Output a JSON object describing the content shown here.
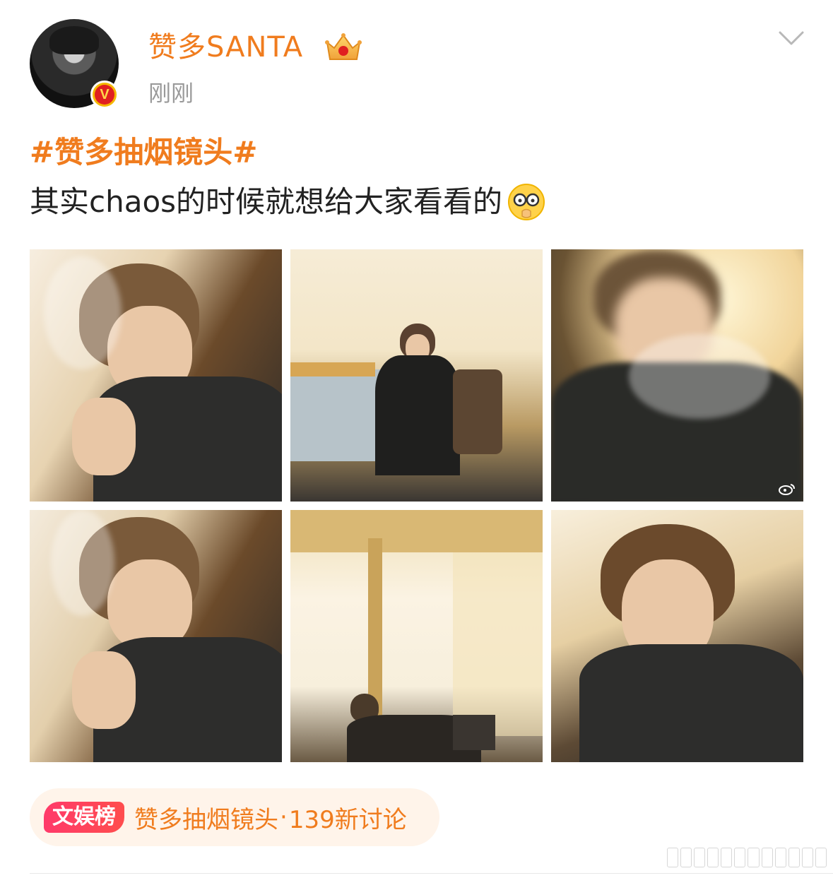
{
  "post": {
    "username": "赞多SANTA",
    "timestamp": "刚刚",
    "hashtag": "#赞多抽烟镜头#",
    "body": "其实chaos的时候就想给大家看看的",
    "emoji": "facepalm-glasses-emoji",
    "verified_badge": "V",
    "member_level_icon": "crown-badge-icon"
  },
  "photos": [
    {
      "label": "photo-1"
    },
    {
      "label": "photo-2"
    },
    {
      "label": "photo-3"
    },
    {
      "label": "photo-4"
    },
    {
      "label": "photo-5"
    },
    {
      "label": "photo-6"
    }
  ],
  "topic": {
    "badge": "文娱榜",
    "title": "赞多抽烟镜头",
    "separator": "·",
    "discussion": "139新讨论"
  },
  "colors": {
    "accent": "#f07c1e",
    "badge_gradient_start": "#ff3a6a",
    "badge_gradient_end": "#ff4d4d",
    "topic_bg": "#fff4ea"
  }
}
